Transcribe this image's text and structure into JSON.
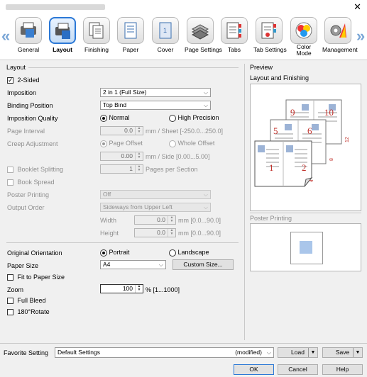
{
  "window": {
    "close_glyph": "✕"
  },
  "nav": {
    "prev_glyph": "«",
    "next_glyph": "»"
  },
  "tabs": [
    {
      "label": "General",
      "icon": "printer-general-icon",
      "selected": false
    },
    {
      "label": "Layout",
      "icon": "layout-icon",
      "selected": true
    },
    {
      "label": "Finishing",
      "icon": "finishing-icon",
      "selected": false
    },
    {
      "label": "Paper",
      "icon": "paper-icon",
      "selected": false
    },
    {
      "label": "Cover",
      "icon": "cover-icon",
      "selected": false
    },
    {
      "label": "Page Settings",
      "icon": "page-settings-icon",
      "selected": false
    },
    {
      "label": "Tabs",
      "icon": "tabs-icon",
      "selected": false
    },
    {
      "label": "Tab Settings",
      "icon": "tab-settings-icon",
      "selected": false
    },
    {
      "label": "Color Mode",
      "label_line1": "Color",
      "label_line2": "Mode",
      "icon": "color-mode-icon",
      "selected": false
    },
    {
      "label": "Management",
      "icon": "management-icon",
      "selected": false
    }
  ],
  "layout": {
    "section_title": "Layout",
    "two_sided": {
      "label": "2-Sided",
      "checked": true
    },
    "imposition": {
      "label": "Imposition",
      "value": "2 in 1 (Full Size)"
    },
    "binding_position": {
      "label": "Binding Position",
      "value": "Top Bind"
    },
    "imposition_quality": {
      "label": "Imposition Quality",
      "opt1": "Normal",
      "opt2": "High Precision",
      "selected": "Normal"
    },
    "page_interval": {
      "label": "Page Interval",
      "value": "0.0",
      "unit": "mm / Sheet [-250.0...250.0]"
    },
    "creep_adjustment": {
      "label": "Creep Adjustment",
      "opt1": "Page Offset",
      "opt2": "Whole Offset",
      "value": "0.00",
      "unit": "mm / Side [0.00...5.00]"
    },
    "booklet_splitting": {
      "label": "Booklet Splitting",
      "value": "1",
      "unit": "Pages per Section"
    },
    "book_spread": {
      "label": "Book Spread"
    },
    "poster_printing": {
      "label": "Poster Printing",
      "value": "Off"
    },
    "output_order": {
      "label": "Output Order",
      "value": "Sideways from Upper Left"
    },
    "width": {
      "label": "Width",
      "value": "0.0",
      "unit": "mm [0.0...90.0]"
    },
    "height": {
      "label": "Height",
      "value": "0.0",
      "unit": "mm [0.0...90.0]"
    },
    "original_orientation": {
      "label": "Original Orientation",
      "opt1": "Portrait",
      "opt2": "Landscape",
      "selected": "Portrait"
    },
    "paper_size": {
      "label": "Paper Size",
      "value": "A4",
      "custom_button": "Custom Size..."
    },
    "fit_to_paper": {
      "label": "Fit to Paper Size"
    },
    "zoom": {
      "label": "Zoom",
      "value": "100",
      "unit": "% [1...1000]"
    },
    "full_bleed": {
      "label": "Full Bleed"
    },
    "rotate": {
      "label": "180°Rotate"
    }
  },
  "preview": {
    "title": "Preview",
    "subtitle": "Layout and Finishing",
    "page_numbers": [
      "9",
      "10",
      "5",
      "6",
      "1",
      "2"
    ],
    "edge_numbers": [
      "12",
      "8",
      "4"
    ],
    "poster_label": "Poster Printing"
  },
  "footer": {
    "favorite_label": "Favorite Setting",
    "favorite_value": "Default Settings",
    "favorite_status": "(modified)",
    "load": "Load",
    "save": "Save",
    "ok": "OK",
    "cancel": "Cancel",
    "help": "Help"
  }
}
